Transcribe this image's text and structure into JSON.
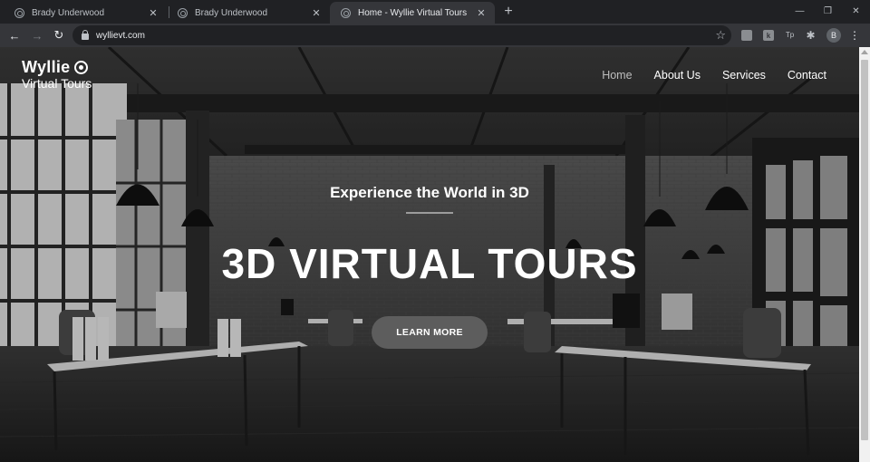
{
  "browser": {
    "tabs": [
      {
        "title": "Brady Underwood",
        "active": false
      },
      {
        "title": "Brady Underwood",
        "active": false
      },
      {
        "title": "Home - Wyllie Virtual Tours",
        "active": true
      }
    ],
    "new_tab_icon": "plus-icon",
    "url": "wyllievt.com",
    "profile_initial": "B",
    "extensions": [
      "extension-1",
      "extension-2",
      "extension-3",
      "puzzle-icon"
    ]
  },
  "site": {
    "logo": {
      "name": "Wyllie",
      "sub": "Virtual Tours"
    },
    "nav": [
      {
        "label": "Home",
        "active": true
      },
      {
        "label": "About Us",
        "active": false
      },
      {
        "label": "Services",
        "active": false
      },
      {
        "label": "Contact",
        "active": false
      }
    ],
    "hero": {
      "tagline": "Experience the World in 3D",
      "title": "3D VIRTUAL TOURS",
      "cta_label": "LEARN MORE"
    }
  },
  "colors": {
    "chrome_dark": "#202124",
    "chrome_toolbar": "#35363a",
    "cta_bg": "#5d5d5d"
  }
}
